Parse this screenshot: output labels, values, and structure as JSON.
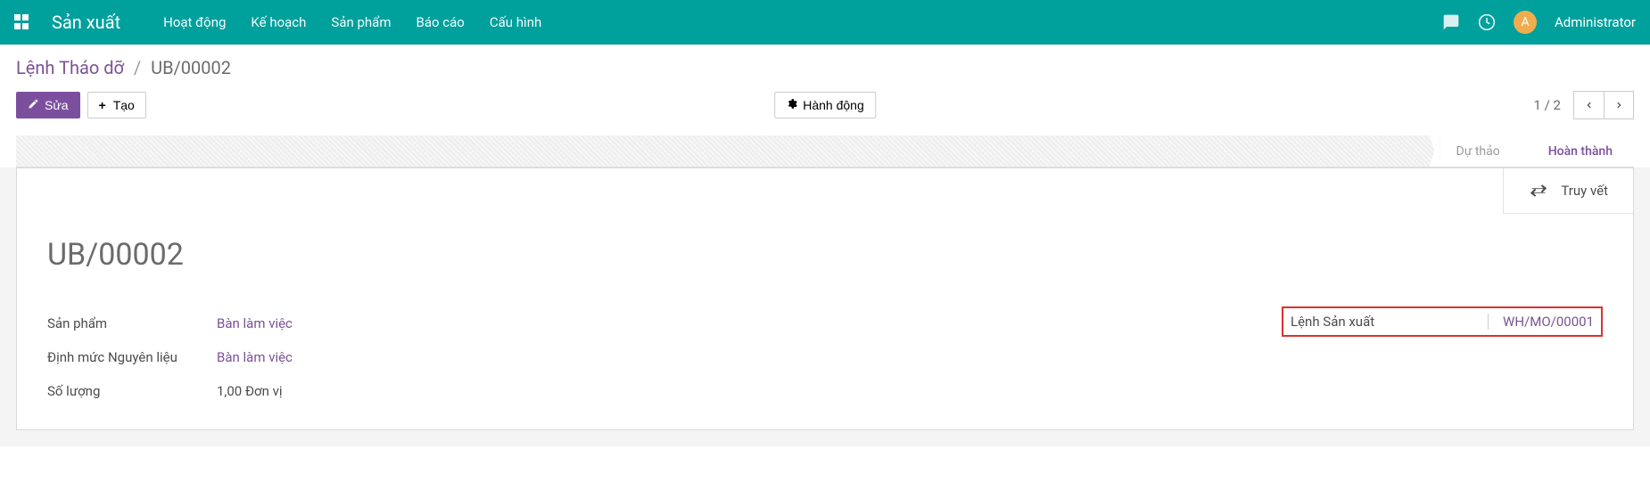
{
  "navbar": {
    "brand": "Sản xuất",
    "menu": [
      "Hoạt động",
      "Kế hoạch",
      "Sản phẩm",
      "Báo cáo",
      "Cấu hình"
    ],
    "user": {
      "initial": "A",
      "name": "Administrator"
    }
  },
  "breadcrumb": {
    "root": "Lệnh Tháo dỡ",
    "sep": "/",
    "current": "UB/00002"
  },
  "toolbar": {
    "edit": "Sửa",
    "create": "Tạo",
    "action": "Hành động",
    "pager": "1 / 2"
  },
  "status": {
    "draft": "Dự thảo",
    "done": "Hoàn thành"
  },
  "stat_button": {
    "label": "Truy vết"
  },
  "record": {
    "title": "UB/00002",
    "left": {
      "product_label": "Sản phẩm",
      "product_value": "Bàn làm việc",
      "bom_label": "Định mức Nguyên liệu",
      "bom_value": "Bàn làm việc",
      "qty_label": "Số lượng",
      "qty_value": "1,00  Đơn vị"
    },
    "right": {
      "mo_label": "Lệnh Sản xuất",
      "mo_value": "WH/MO/00001"
    }
  }
}
